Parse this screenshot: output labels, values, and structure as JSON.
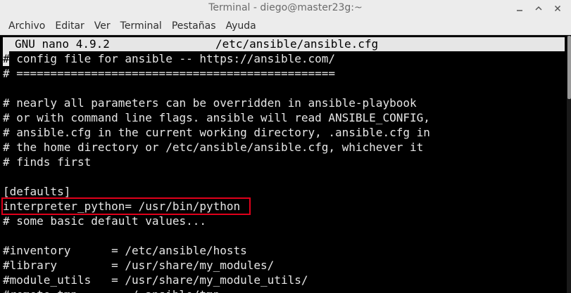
{
  "window": {
    "title": "Terminal - diego@master23g:~"
  },
  "menu": {
    "items": [
      "Archivo",
      "Editar",
      "Ver",
      "Terminal",
      "Pestañas",
      "Ayuda"
    ]
  },
  "nano": {
    "version": "GNU nano 4.9.2",
    "filename": "/etc/ansible/ansible.cfg"
  },
  "cursor": {
    "char": "#"
  },
  "editor": {
    "lines": [
      "# config file for ansible -- https://ansible.com/",
      "# ===============================================",
      "",
      "# nearly all parameters can be overridden in ansible-playbook",
      "# or with command line flags. ansible will read ANSIBLE_CONFIG,",
      "# ansible.cfg in the current working directory, .ansible.cfg in",
      "# the home directory or /etc/ansible/ansible.cfg, whichever it",
      "# finds first",
      "",
      "[defaults]",
      "interpreter_python= /usr/bin/python",
      "# some basic default values...",
      "",
      "#inventory      = /etc/ansible/hosts",
      "#library        = /usr/share/my_modules/",
      "#module_utils   = /usr/share/my_module_utils/",
      "#remote_tmp     = ~/.ansible/tmp"
    ]
  },
  "colors": {
    "highlight": "#e0001b",
    "terminal_bg": "#000000",
    "terminal_fg": "#e6e6e6"
  }
}
